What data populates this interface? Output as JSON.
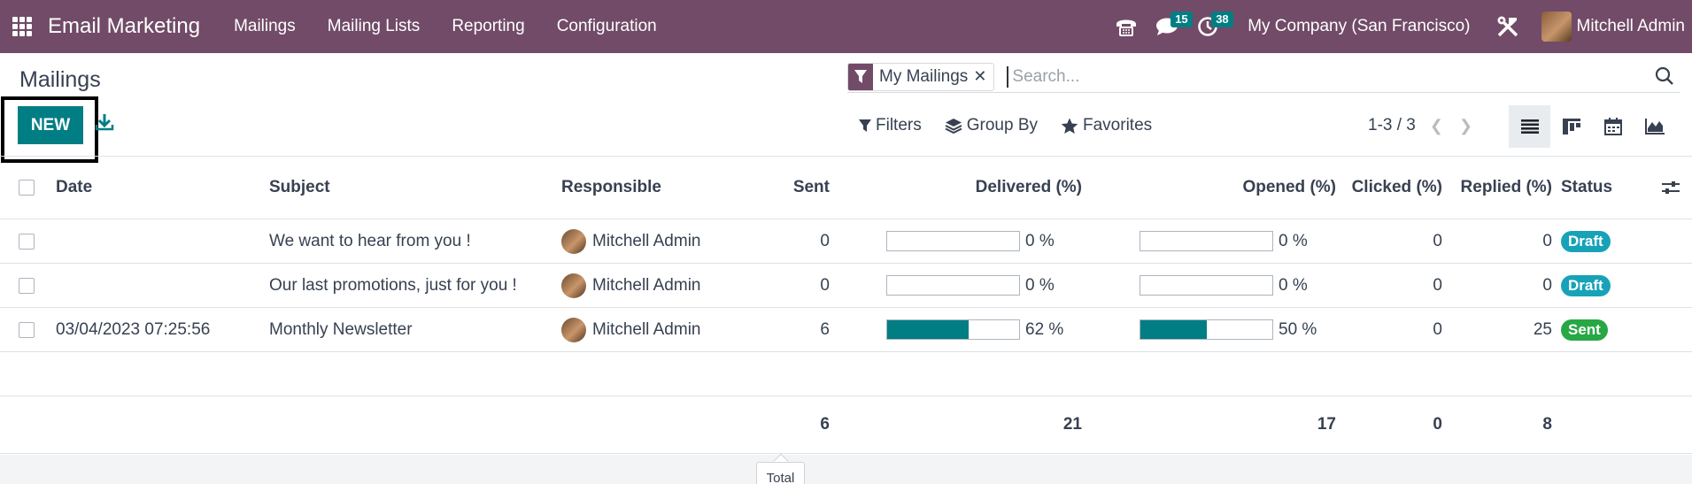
{
  "navbar": {
    "app_name": "Email Marketing",
    "menu": [
      "Mailings",
      "Mailing Lists",
      "Reporting",
      "Configuration"
    ],
    "messages_badge": "15",
    "activities_badge": "38",
    "company": "My Company (San Francisco)",
    "user_name": "Mitchell Admin",
    "color": "#714B67"
  },
  "control_panel": {
    "title": "Mailings",
    "new_label": "NEW",
    "search": {
      "facet_label": "My Mailings",
      "placeholder": "Search..."
    },
    "filters_label": "Filters",
    "group_by_label": "Group By",
    "favorites_label": "Favorites",
    "pager_value": "1-3 / 3",
    "views": [
      "list-view-icon",
      "kanban-view-icon",
      "calendar-view-icon",
      "graph-view-icon"
    ],
    "active_view": "list-view-icon"
  },
  "table": {
    "columns": [
      "Date",
      "Subject",
      "Responsible",
      "Sent",
      "Delivered (%)",
      "Opened (%)",
      "Clicked (%)",
      "Replied (%)",
      "Status"
    ],
    "rows": [
      {
        "date": "",
        "subject": "We want to hear from you !",
        "responsible": "Mitchell Admin",
        "sent": "0",
        "delivered_pct": 0,
        "delivered_label": "0 %",
        "opened_pct": 0,
        "opened_label": "0 %",
        "clicked": "0",
        "replied": "0",
        "status": "Draft"
      },
      {
        "date": "",
        "subject": "Our last promotions, just for you !",
        "responsible": "Mitchell Admin",
        "sent": "0",
        "delivered_pct": 0,
        "delivered_label": "0 %",
        "opened_pct": 0,
        "opened_label": "0 %",
        "clicked": "0",
        "replied": "0",
        "status": "Draft"
      },
      {
        "date": "03/04/2023 07:25:56",
        "subject": "Monthly Newsletter",
        "responsible": "Mitchell Admin",
        "sent": "6",
        "delivered_pct": 62,
        "delivered_label": "62 %",
        "opened_pct": 50,
        "opened_label": "50 %",
        "clicked": "0",
        "replied": "25",
        "status": "Sent"
      }
    ],
    "totals": {
      "sent": "6",
      "delivered": "21",
      "opened": "17",
      "clicked": "0",
      "replied": "8"
    },
    "total_tooltip": "Total",
    "accent": "#017E84",
    "status_colors": {
      "Draft": "#17a2b8",
      "Sent": "#28a745"
    }
  }
}
